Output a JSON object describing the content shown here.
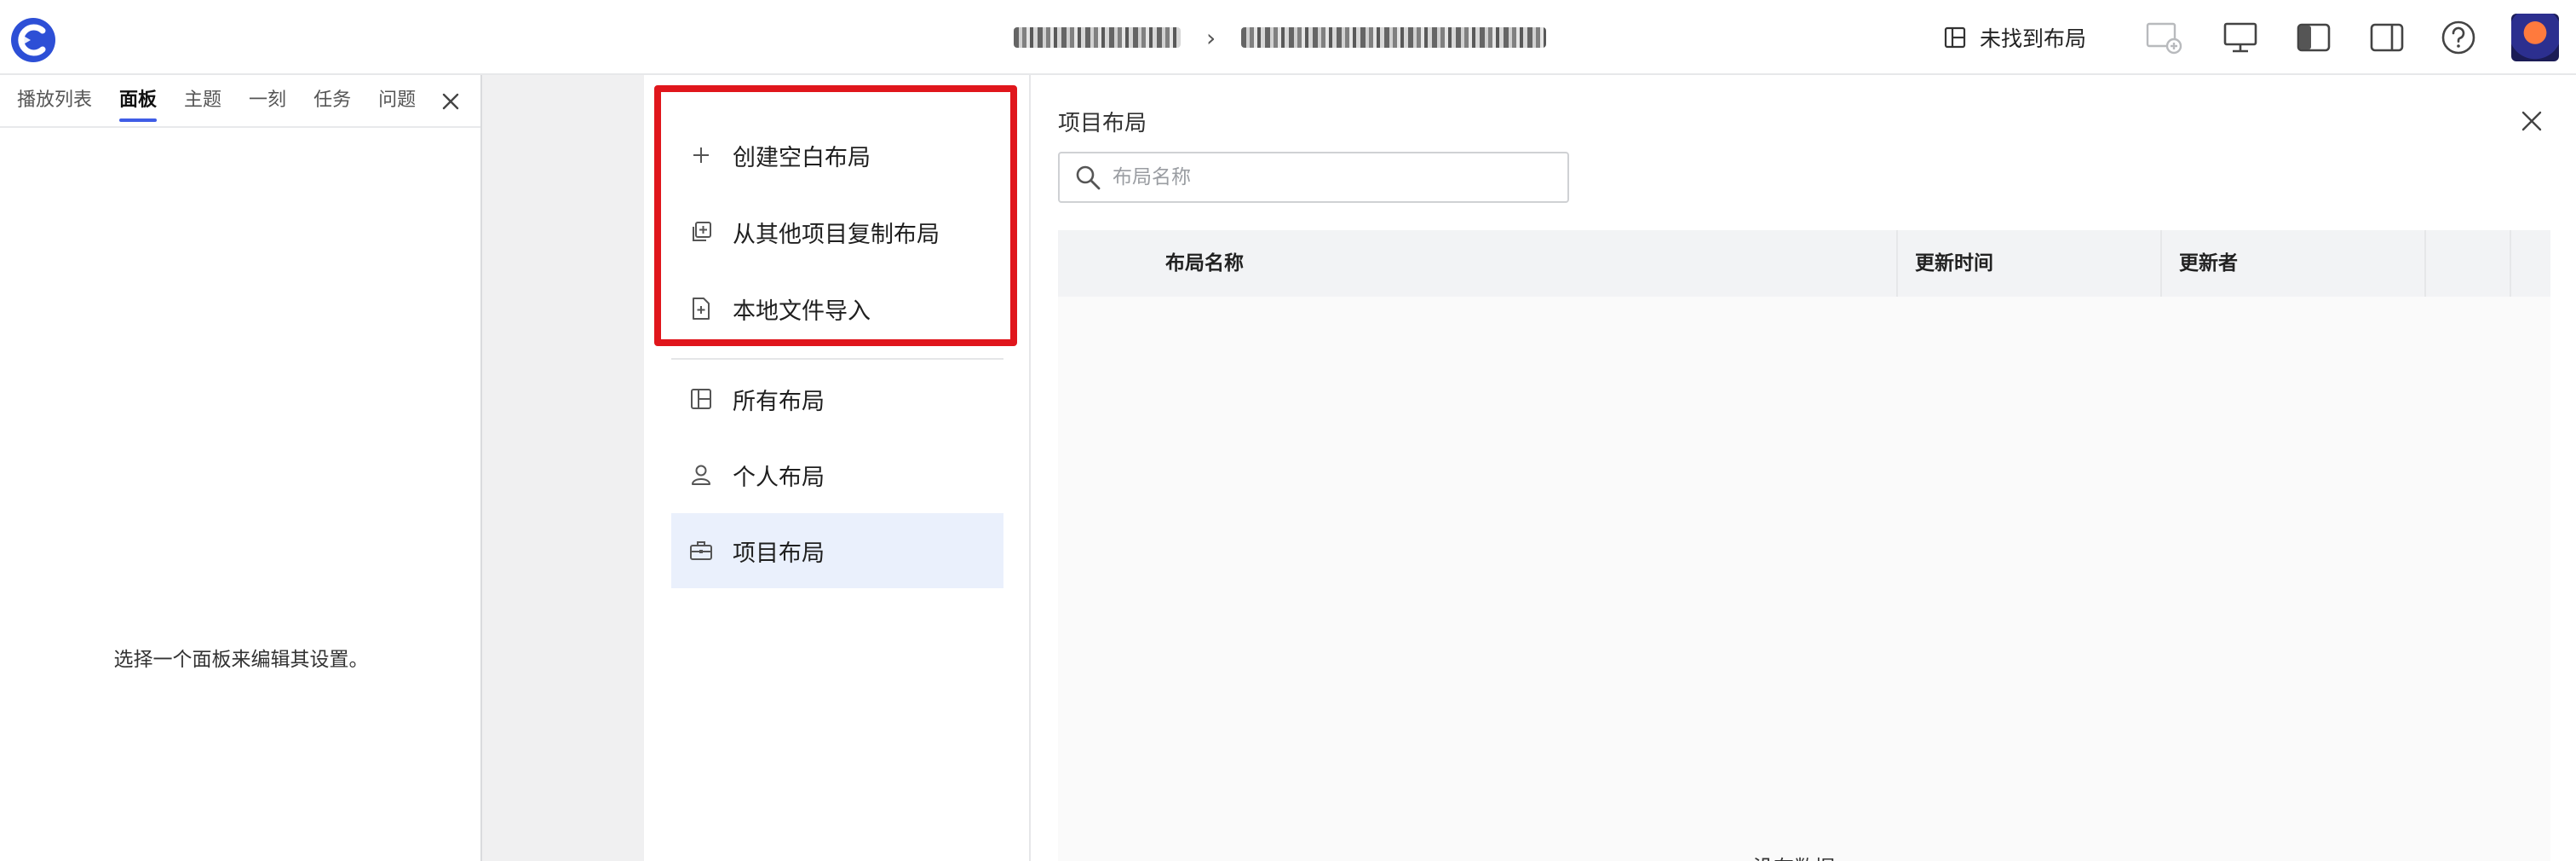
{
  "header": {
    "breadcrumb": [
      "[blurred project]",
      "[blurred dashboard]"
    ],
    "layout_button": "未找到布局",
    "icons": [
      "logo-icon",
      "layout-icon",
      "add-panel-icon",
      "monitor-icon",
      "left-sidebar-icon",
      "right-sidebar-icon",
      "help-icon"
    ]
  },
  "left_panel": {
    "tabs": [
      "播放列表",
      "面板",
      "主题",
      "一刻",
      "任务",
      "问题"
    ],
    "active_tab": "面板",
    "empty_message": "选择一个面板来编辑其设置。"
  },
  "layout_menu": {
    "items": [
      {
        "label": "创建空白布局",
        "icon": "plus-icon"
      },
      {
        "label": "从其他项目复制布局",
        "icon": "copy-icon"
      },
      {
        "label": "本地文件导入",
        "icon": "file-import-icon"
      },
      {
        "label": "所有布局",
        "icon": "layout-icon"
      },
      {
        "label": "个人布局",
        "icon": "user-icon"
      },
      {
        "label": "项目布局",
        "icon": "briefcase-icon"
      }
    ],
    "selected": "项目布局",
    "highlight_color": "#e0161c"
  },
  "content": {
    "title": "项目布局",
    "search": {
      "placeholder": "布局名称",
      "value": ""
    },
    "table": {
      "columns": [
        "布局名称",
        "更新时间",
        "更新者"
      ],
      "rows": [],
      "empty_text": "没有数据。"
    }
  },
  "colors": {
    "accent": "#3f5de6",
    "selected_bg": "#eaf0fc",
    "header_bg": "#f2f3f5"
  }
}
